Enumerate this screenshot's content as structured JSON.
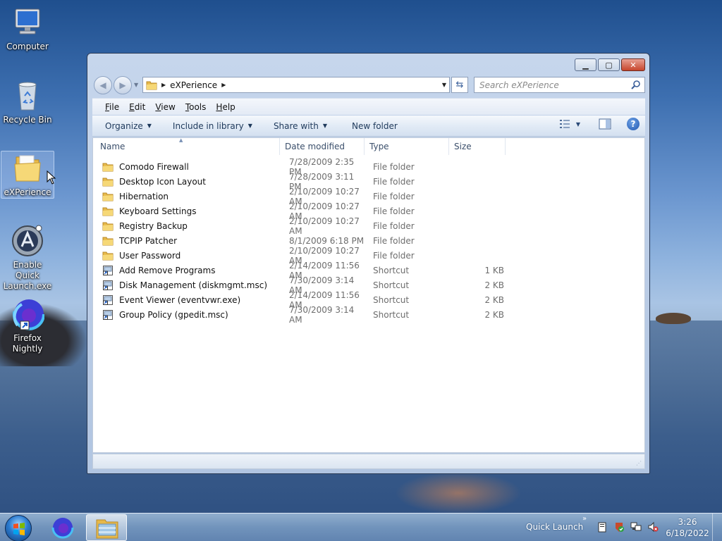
{
  "desktop": {
    "icons": [
      {
        "label": "Computer"
      },
      {
        "label": "Recycle Bin"
      },
      {
        "label": "eXPerience"
      },
      {
        "label": "Enable Quick Launch.exe"
      },
      {
        "label": "Firefox Nightly"
      }
    ]
  },
  "window": {
    "address": {
      "crumb": "eXPerience"
    },
    "search": {
      "placeholder": "Search eXPerience"
    },
    "menu": [
      {
        "label": "File",
        "accel": "F",
        "rest": "ile"
      },
      {
        "label": "Edit",
        "accel": "E",
        "rest": "dit"
      },
      {
        "label": "View",
        "accel": "V",
        "rest": "iew"
      },
      {
        "label": "Tools",
        "accel": "T",
        "rest": "ools"
      },
      {
        "label": "Help",
        "accel": "H",
        "rest": "elp"
      }
    ],
    "commands": {
      "organize": "Organize",
      "include_in_library": "Include in library",
      "share_with": "Share with",
      "new_folder": "New folder"
    },
    "columns": {
      "name": "Name",
      "date_modified": "Date modified",
      "type": "Type",
      "size": "Size"
    },
    "files": [
      {
        "name": "Comodo Firewall",
        "date": "7/28/2009 2:35 PM",
        "type": "File folder",
        "size": "",
        "icon": "folder-icon"
      },
      {
        "name": "Desktop Icon Layout",
        "date": "7/28/2009 3:11 PM",
        "type": "File folder",
        "size": "",
        "icon": "folder-icon"
      },
      {
        "name": "Hibernation",
        "date": "2/10/2009 10:27 AM",
        "type": "File folder",
        "size": "",
        "icon": "folder-icon"
      },
      {
        "name": "Keyboard Settings",
        "date": "2/10/2009 10:27 AM",
        "type": "File folder",
        "size": "",
        "icon": "folder-icon"
      },
      {
        "name": "Registry Backup",
        "date": "2/10/2009 10:27 AM",
        "type": "File folder",
        "size": "",
        "icon": "folder-icon"
      },
      {
        "name": "TCPIP Patcher",
        "date": "8/1/2009 6:18 PM",
        "type": "File folder",
        "size": "",
        "icon": "folder-icon"
      },
      {
        "name": "User Password",
        "date": "2/10/2009 10:27 AM",
        "type": "File folder",
        "size": "",
        "icon": "folder-icon"
      },
      {
        "name": "Add Remove Programs",
        "date": "2/14/2009 11:56 AM",
        "type": "Shortcut",
        "size": "1 KB",
        "icon": "shortcut-icon"
      },
      {
        "name": "Disk Management (diskmgmt.msc)",
        "date": "7/30/2009 3:14 AM",
        "type": "Shortcut",
        "size": "2 KB",
        "icon": "shortcut-icon"
      },
      {
        "name": "Event Viewer (eventvwr.exe)",
        "date": "2/14/2009 11:56 AM",
        "type": "Shortcut",
        "size": "2 KB",
        "icon": "shortcut-icon"
      },
      {
        "name": "Group Policy (gpedit.msc)",
        "date": "7/30/2009 3:14 AM",
        "type": "Shortcut",
        "size": "2 KB",
        "icon": "shortcut-icon"
      }
    ]
  },
  "taskbar": {
    "quick_launch": "Quick Launch",
    "time": "3:26",
    "date": "6/18/2022"
  },
  "colors": {
    "folder": "#f3cf5c",
    "accent": "#1e395b"
  }
}
